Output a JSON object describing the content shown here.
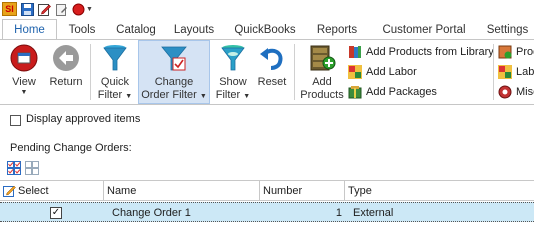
{
  "quick_access": {
    "logo_text": "SI"
  },
  "tabs": [
    {
      "label": "Home",
      "active": true
    },
    {
      "label": "Tools"
    },
    {
      "label": "Catalog"
    },
    {
      "label": "Layouts"
    },
    {
      "label": "QuickBooks"
    },
    {
      "label": "Reports"
    },
    {
      "label": "Customer Portal"
    },
    {
      "label": "Settings"
    }
  ],
  "ribbon": {
    "view": {
      "label": "View"
    },
    "return": {
      "label": "Return"
    },
    "quick_filter": {
      "line1": "Quick",
      "line2": "Filter"
    },
    "change_order_filter": {
      "line1": "Change",
      "line2": "Order Filter"
    },
    "show_filter": {
      "line1": "Show",
      "line2": "Filter"
    },
    "reset": {
      "label": "Reset"
    },
    "add_products": {
      "line1": "Add",
      "line2": "Products"
    },
    "add_products_from_library": "Add Products from Library",
    "add_labor": "Add Labor",
    "add_packages": "Add Packages",
    "right_cut_1": "Prod",
    "right_cut_2": "Labo",
    "right_cut_3": "Misc"
  },
  "content": {
    "display_approved_label": "Display approved items",
    "pending_label": "Pending Change Orders:"
  },
  "grid": {
    "columns": [
      "Select",
      "Name",
      "Number",
      "Type"
    ],
    "rows": [
      {
        "selected": true,
        "name": "Change Order 1",
        "number": "1",
        "type": "External"
      }
    ]
  },
  "colors": {
    "accent": "#1f63ad",
    "ribbon_selected": "#d5e3f4",
    "row_selected": "#cce8f6"
  }
}
